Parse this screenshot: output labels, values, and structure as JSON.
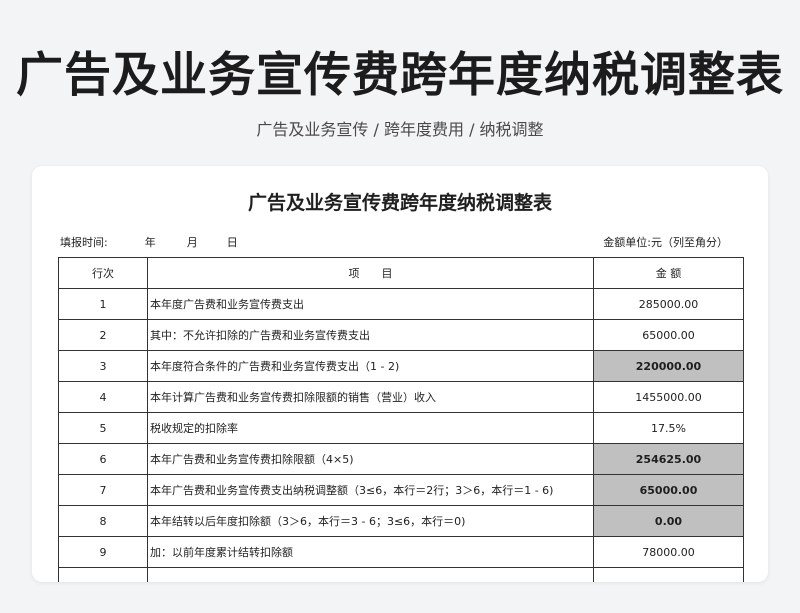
{
  "page": {
    "title": "广告及业务宣传费跨年度纳税调整表",
    "subtitle": "广告及业务宣传 / 跨年度费用 / 纳税调整"
  },
  "sheet": {
    "title": "广告及业务宣传费跨年度纳税调整表",
    "fill_time_label": "填报时间:",
    "year_label": "年",
    "month_label": "月",
    "day_label": "日",
    "unit_label": "金额单位:元（列至角分）",
    "headers": {
      "row_no": "行次",
      "item": "项　　目",
      "amount": "金 额"
    },
    "rows": [
      {
        "no": "1",
        "item": "本年度广告费和业务宣传费支出",
        "amount": "285000.00",
        "highlight": false
      },
      {
        "no": "2",
        "item": "其中：不允许扣除的广告费和业务宣传费支出",
        "amount": "65000.00",
        "highlight": false
      },
      {
        "no": "3",
        "item": "本年度符合条件的广告费和业务宣传费支出（1 - 2)",
        "amount": "220000.00",
        "highlight": true
      },
      {
        "no": "4",
        "item": "本年计算广告费和业务宣传费扣除限额的销售（营业）收入",
        "amount": "1455000.00",
        "highlight": false
      },
      {
        "no": "5",
        "item": "税收规定的扣除率",
        "amount": "17.5%",
        "highlight": false
      },
      {
        "no": "6",
        "item": "本年广告费和业务宣传费扣除限额（4×5)",
        "amount": "254625.00",
        "highlight": true
      },
      {
        "no": "7",
        "item": "本年广告费和业务宣传费支出纳税调整额（3≤6，本行＝2行；3＞6，本行＝1 - 6)",
        "amount": "65000.00",
        "highlight": true
      },
      {
        "no": "8",
        "item": "本年结转以后年度扣除额（3＞6，本行＝3 - 6；3≤6，本行＝0)",
        "amount": "0.00",
        "highlight": true
      },
      {
        "no": "9",
        "item": "加：以前年度累计结转扣除额",
        "amount": "78000.00",
        "highlight": false
      },
      {
        "no": "",
        "item": "",
        "amount": "",
        "highlight": false
      }
    ]
  },
  "colors": {
    "highlight": "#c0c0c0",
    "background": "#f3f4f6"
  }
}
